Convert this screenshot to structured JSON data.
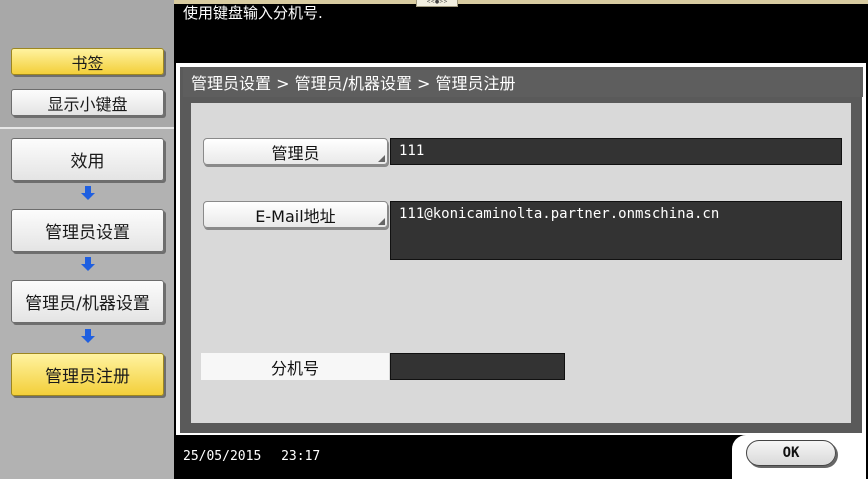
{
  "message": "使用键盘输入分机号.",
  "sidebar": {
    "bookmark_label": "书签",
    "keypad_label": "显示小键盘",
    "steps": [
      {
        "label": "效用"
      },
      {
        "label": "管理员设置"
      },
      {
        "label": "管理员/机器设置"
      },
      {
        "label": "管理员注册"
      }
    ]
  },
  "breadcrumb": "管理员设置 > 管理员/机器设置 > 管理员注册",
  "form": {
    "admin_label": "管理员",
    "admin_value": "111",
    "email_label": "E-Mail地址",
    "email_value": "111@konicaminolta.partner.onmschina.cn",
    "ext_label": "分机号",
    "ext_value": ""
  },
  "status": {
    "date": "25/05/2015",
    "time": "23:17"
  },
  "ok_label": "OK",
  "icons": {
    "step_arrow": "down-arrow-icon",
    "corner": "corner-indicator-icon"
  },
  "colors": {
    "accent_yellow": "#f3cf3a",
    "arrow_blue": "#1f5fe0",
    "field_dark": "#333333"
  }
}
